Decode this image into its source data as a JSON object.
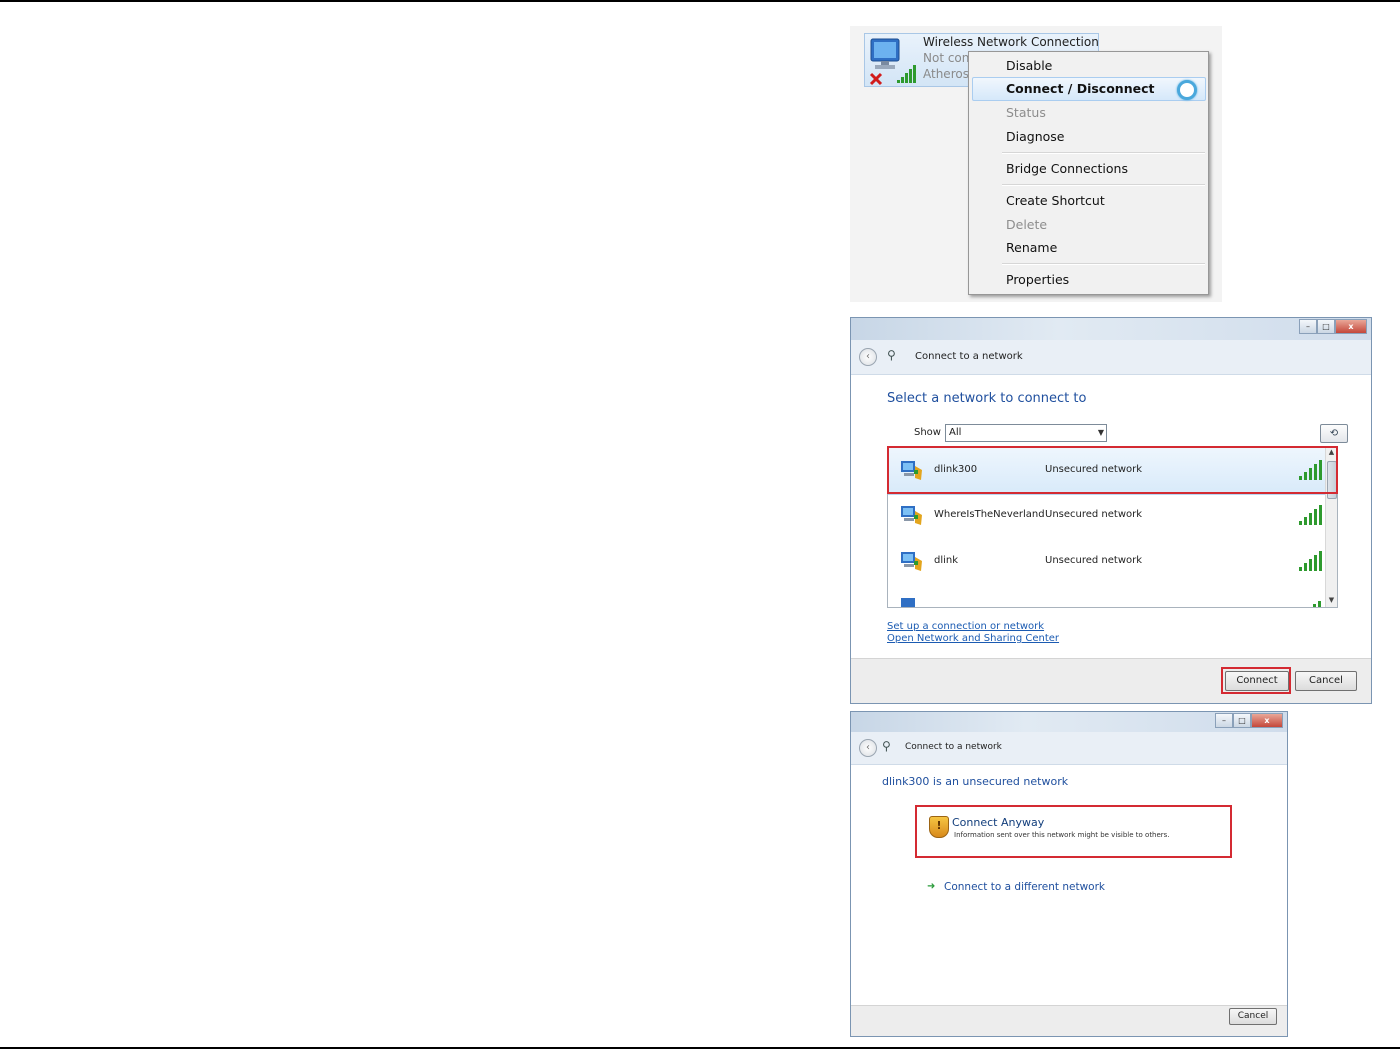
{
  "colors": {
    "highlight_border": "#d42a32",
    "link": "#1b5bb2",
    "heading": "#1f4f9e",
    "signal_bars": "#2e9a2e",
    "menu_highlight": "#d5e8fa"
  },
  "connection": {
    "name": "Wireless Network Connection",
    "status": "Not con",
    "device": "Atheros",
    "icons": [
      "network-adapter-icon",
      "disconnected-x-icon",
      "signal-strength-icon"
    ]
  },
  "context_menu": {
    "items": [
      {
        "label": "Disable",
        "enabled": true
      },
      {
        "label": "Connect / Disconnect",
        "enabled": true,
        "highlighted": true
      },
      {
        "label": "Status",
        "enabled": false
      },
      {
        "label": "Diagnose",
        "enabled": true
      },
      {
        "label": "Bridge Connections",
        "enabled": true
      },
      {
        "label": "Create Shortcut",
        "enabled": true
      },
      {
        "label": "Delete",
        "enabled": false
      },
      {
        "label": "Rename",
        "enabled": true
      },
      {
        "label": "Properties",
        "enabled": true
      }
    ],
    "busy_icon": "busy-spinner-icon"
  },
  "connect_dialog": {
    "nav_title": "Connect to a network",
    "heading": "Select a network to connect to",
    "show_label": "Show",
    "show_value": "All",
    "networks": [
      {
        "name": "dlink300",
        "security": "Unsecured network",
        "selected": true
      },
      {
        "name": "WhereIsTheNeverland",
        "security": "Unsecured network",
        "selected": false
      },
      {
        "name": "dlink",
        "security": "Unsecured network",
        "selected": false
      }
    ],
    "links": {
      "setup": "Set up a connection or network",
      "sharing_center": "Open Network and Sharing Center"
    },
    "buttons": {
      "connect": "Connect",
      "cancel": "Cancel"
    }
  },
  "unsecured_dialog": {
    "nav_title": "Connect to a network",
    "heading": "dlink300 is an unsecured network",
    "connect_anyway": {
      "title": "Connect Anyway",
      "description": "Information sent over this network might be visible to others."
    },
    "different_network": "Connect to a different network",
    "buttons": {
      "cancel": "Cancel"
    }
  }
}
